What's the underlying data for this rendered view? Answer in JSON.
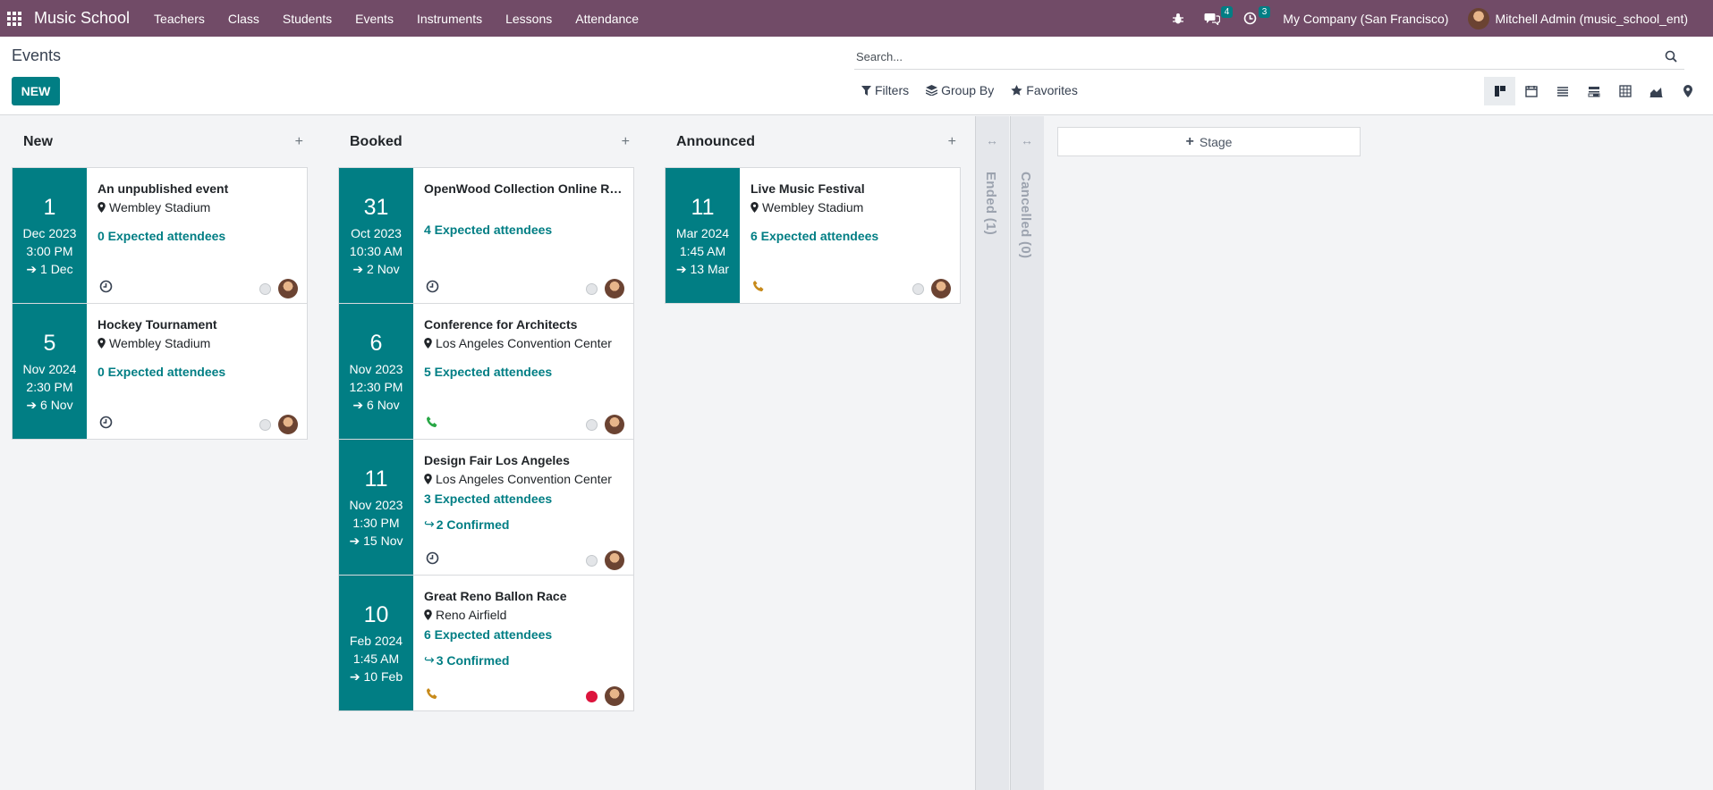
{
  "navbar": {
    "app_name": "Music School",
    "menu": [
      "Teachers",
      "Class",
      "Students",
      "Events",
      "Instruments",
      "Lessons",
      "Attendance"
    ],
    "messages_count": "4",
    "activities_count": "3",
    "company": "My Company (San Francisco)",
    "user": "Mitchell Admin (music_school_ent)"
  },
  "control": {
    "title": "Events",
    "new_label": "NEW",
    "search_placeholder": "Search...",
    "filters_label": "Filters",
    "group_by_label": "Group By",
    "favorites_label": "Favorites",
    "views": [
      "kanban-icon",
      "calendar-icon",
      "list-icon",
      "gantt-icon",
      "pivot-icon",
      "graph-icon",
      "map-icon"
    ]
  },
  "kanban": {
    "columns": [
      {
        "title": "New",
        "cards": [
          {
            "day": "1",
            "month_year": "Dec 2023",
            "time": "3:00 PM",
            "end": "1 Dec",
            "name": "An unpublished event",
            "location": "Wembley Stadium",
            "attendees": "0 Expected attendees",
            "confirmed": "",
            "activity": "clock",
            "state": "normal"
          },
          {
            "day": "5",
            "month_year": "Nov 2024",
            "time": "2:30 PM",
            "end": "6 Nov",
            "name": "Hockey Tournament",
            "location": "Wembley Stadium",
            "attendees": "0 Expected attendees",
            "confirmed": "",
            "activity": "clock",
            "state": "normal"
          }
        ]
      },
      {
        "title": "Booked",
        "cards": [
          {
            "day": "31",
            "month_year": "Oct 2023",
            "time": "10:30 AM",
            "end": "2 Nov",
            "name": "OpenWood Collection Online Reveal",
            "location": "",
            "attendees": "4 Expected attendees",
            "confirmed": "",
            "activity": "clock",
            "state": "normal"
          },
          {
            "day": "6",
            "month_year": "Nov 2023",
            "time": "12:30 PM",
            "end": "6 Nov",
            "name": "Conference for Architects",
            "location": "Los Angeles Convention Center",
            "attendees": "5 Expected attendees",
            "confirmed": "",
            "activity": "phone-green",
            "state": "normal"
          },
          {
            "day": "11",
            "month_year": "Nov 2023",
            "time": "1:30 PM",
            "end": "15 Nov",
            "name": "Design Fair Los Angeles",
            "location": "Los Angeles Convention Center",
            "attendees": "3 Expected attendees",
            "confirmed": "2 Confirmed",
            "activity": "clock",
            "state": "normal"
          },
          {
            "day": "10",
            "month_year": "Feb 2024",
            "time": "1:45 AM",
            "end": "10 Feb",
            "name": "Great Reno Ballon Race",
            "location": "Reno Airfield",
            "attendees": "6 Expected attendees",
            "confirmed": "3 Confirmed",
            "activity": "phone-orange",
            "state": "blocked"
          }
        ]
      },
      {
        "title": "Announced",
        "cards": [
          {
            "day": "11",
            "month_year": "Mar 2024",
            "time": "1:45 AM",
            "end": "13 Mar",
            "name": "Live Music Festival",
            "location": "Wembley Stadium",
            "attendees": "6 Expected attendees",
            "confirmed": "",
            "activity": "phone-orange",
            "state": "normal"
          }
        ]
      }
    ],
    "folded": [
      {
        "label": "Ended (1)"
      },
      {
        "label": "Cancelled (0)"
      }
    ],
    "add_stage_label": "Stage"
  },
  "colors": {
    "navbar": "#714B67",
    "accent": "#017e84",
    "blocked": "#dc143c"
  }
}
